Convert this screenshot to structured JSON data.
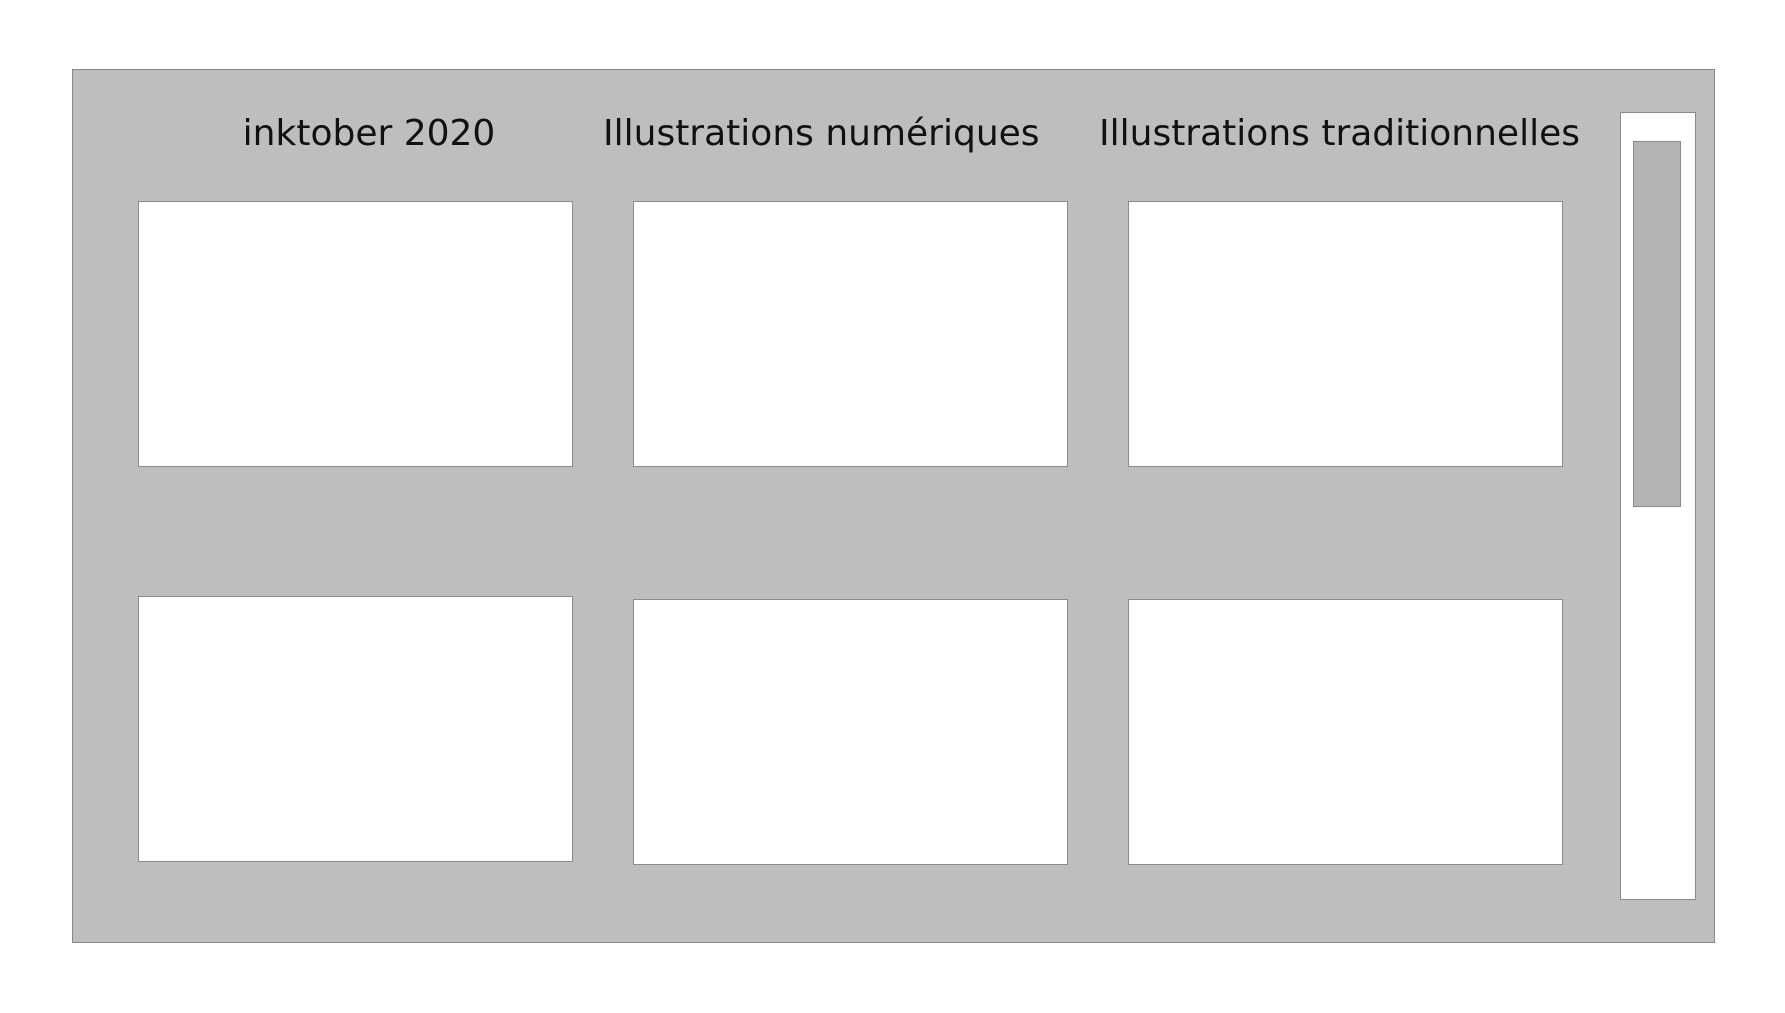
{
  "gallery": {
    "columns": [
      {
        "title": "inktober 2020"
      },
      {
        "title": "Illustrations numériques"
      },
      {
        "title": "Illustrations traditionnelles"
      }
    ]
  },
  "colors": {
    "panel_background": "#bebebe",
    "tile_background": "#ffffff",
    "scroll_thumb": "#b3b3b3",
    "border": "#8a8a8a"
  }
}
